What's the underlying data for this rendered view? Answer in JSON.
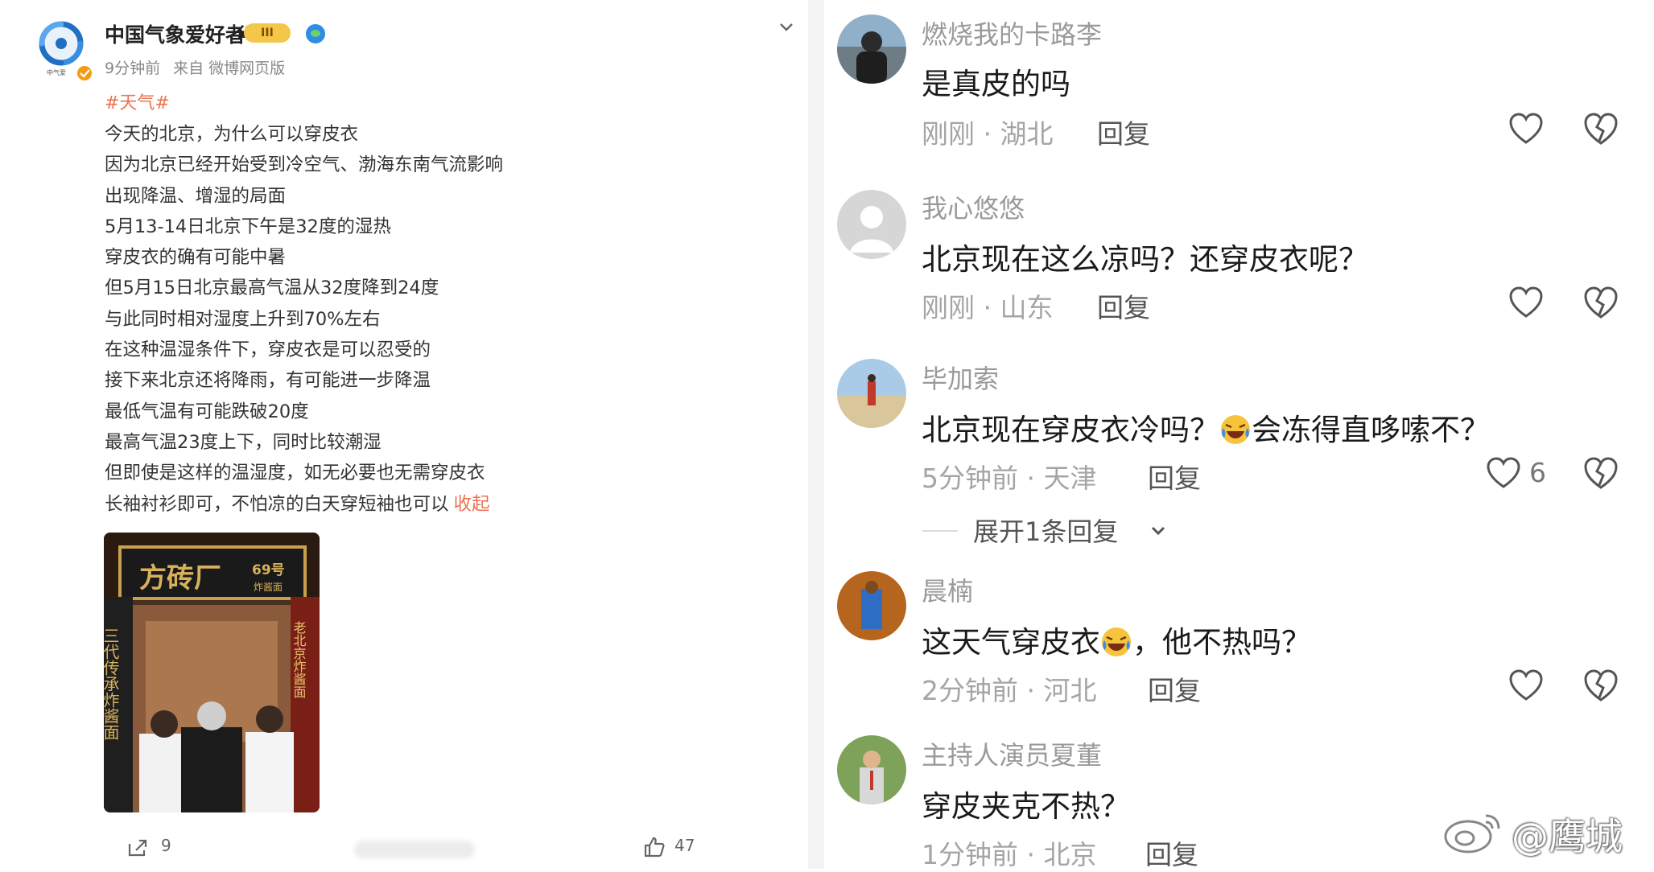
{
  "post": {
    "author": "中国气象爱好者",
    "vip_badge": "III",
    "logo_text": "中气爱",
    "time": "9分钟前",
    "source": "来自 微博网页版",
    "hashtag": "#天气#",
    "lines": [
      "今天的北京，为什么可以穿皮衣",
      "因为北京已经开始受到冷空气、渤海东南气流影响",
      "出现降温、增湿的局面",
      "5月13-14日北京下午是32度的湿热",
      "穿皮衣的确有可能中暑",
      "但5月15日北京最高气温从32度降到24度",
      "与此同时相对湿度上升到70%左右",
      "在这种温湿条件下，穿皮衣是可以忍受的",
      "接下来北京还将降雨，有可能进一步降温",
      "最低气温有可能跌破20度",
      "最高气温23度上下，同时比较潮湿",
      "但即使是这样的温湿度，如无必要也无需穿皮衣"
    ],
    "last_line": "长袖衬衫即可，不怕凉的白天穿短袖也可以",
    "collapse_label": "收起",
    "photo": {
      "sign_main": "方砖厂",
      "sign_badge": "69号",
      "sign_small": "炸酱面",
      "side_left": "三代传承炸酱面",
      "side_right": "老北京炸酱面"
    },
    "share_count": "9",
    "like_count": "47"
  },
  "comments": [
    {
      "name": "燃烧我的卡路李",
      "text": "是真皮的吗",
      "time": "刚刚",
      "location": "湖北",
      "reply": "回复",
      "likes": ""
    },
    {
      "name": "我心悠悠",
      "text": "北京现在这么凉吗？还穿皮衣呢？",
      "time": "刚刚",
      "location": "山东",
      "reply": "回复",
      "likes": ""
    },
    {
      "name": "毕加索",
      "text_a": "北京现在穿皮衣冷吗？",
      "text_b": "会冻得直哆嗦不？",
      "time": "5分钟前",
      "location": "天津",
      "reply": "回复",
      "likes": "6"
    },
    {
      "name": "晨楠",
      "text_a": "这天气穿皮衣",
      "text_b": "，他不热吗？",
      "time": "2分钟前",
      "location": "河北",
      "reply": "回复",
      "likes": ""
    },
    {
      "name": "主持人演员夏董",
      "text": "穿皮夹克不热？",
      "time": "1分钟前",
      "location": "北京",
      "reply": "回复",
      "likes": ""
    }
  ],
  "expand_replies": "展开1条回复",
  "separator": "·",
  "watermark": "@鹰城",
  "colors": {
    "accent": "#eb7350",
    "muted": "#9a9a9a",
    "link_blue": "#2e8de6"
  },
  "icons": [
    "weather-logo-icon",
    "vip-crown-icon",
    "verified-icon",
    "chevron-down-icon",
    "share-icon",
    "like-icon",
    "heart-icon",
    "broken-heart-icon",
    "laughing-crying-emoji",
    "weibo-logo-icon"
  ]
}
